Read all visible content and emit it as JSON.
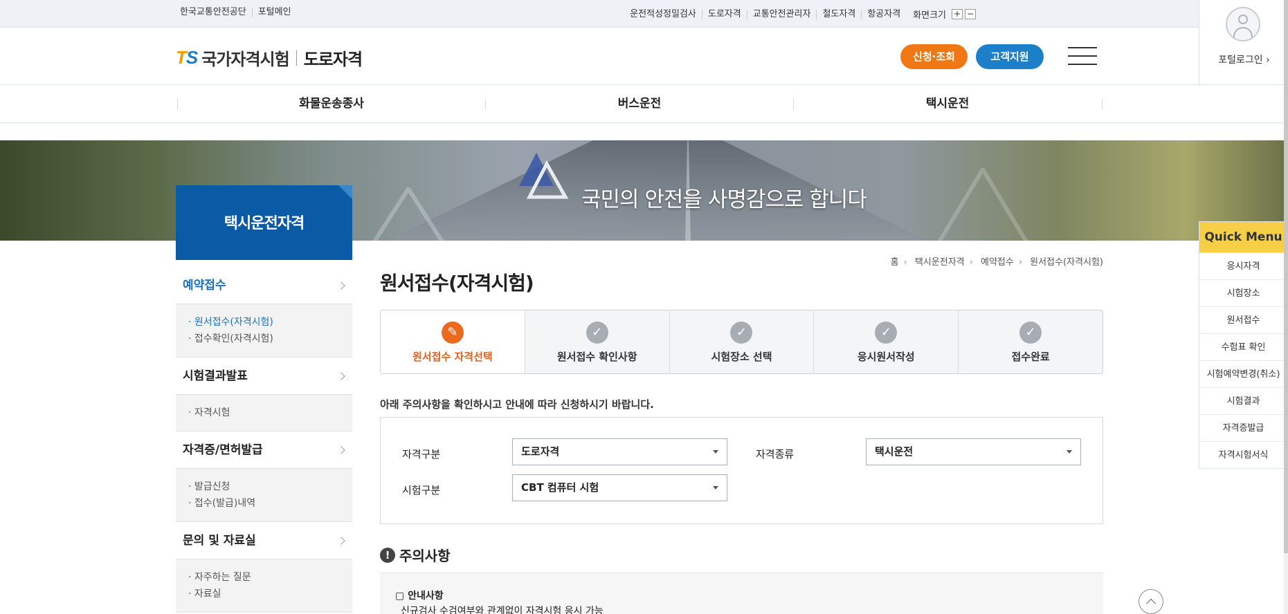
{
  "util": {
    "left": [
      "한국교통안전공단",
      "포털메인"
    ],
    "right": [
      "운전적성정밀검사",
      "도로자격",
      "교통안전관리자",
      "철도자격",
      "항공자격"
    ],
    "font_size_label": "화면크기",
    "plus": "+",
    "minus": "−"
  },
  "header": {
    "logo_t": "T",
    "logo_s": "S",
    "logo_name": "국가자격시험",
    "logo_sub": "도로자격",
    "apply_btn": "신청·조회",
    "support_btn": "고객지원",
    "login_label": "포털로그인 ›"
  },
  "gnb": [
    "화물운송종사",
    "버스운전",
    "택시운전"
  ],
  "banner": {
    "text": "국민의 안전을 사명감으로 합니다"
  },
  "side_title": "택시운전자격",
  "lnb": [
    {
      "label": "예약접수",
      "active": true,
      "subs": [
        "· 원서접수(자격시험)",
        "· 접수확인(자격시험)"
      ]
    },
    {
      "label": "시험결과발표",
      "active": false,
      "subs": [
        "· 자격시험"
      ]
    },
    {
      "label": "자격증/면허발급",
      "active": false,
      "subs": [
        "· 발급신청",
        "· 접수(발급)내역"
      ]
    },
    {
      "label": "문의 및 자료실",
      "active": false,
      "subs": [
        "· 자주하는 질문",
        "· 자료실"
      ]
    }
  ],
  "breadcrumb": [
    "홈",
    "택시운전자격",
    "예약접수",
    "원서접수(자격시험)"
  ],
  "page_title": "원서접수(자격시험)",
  "steps": [
    {
      "label": "원서접수 자격선택",
      "active": true
    },
    {
      "label": "원서접수 확인사항",
      "active": false
    },
    {
      "label": "시험장소 선택",
      "active": false
    },
    {
      "label": "응시원서작성",
      "active": false
    },
    {
      "label": "접수완료",
      "active": false
    }
  ],
  "notice": "아래 주의사항을 확인하시고 안내에 따라 신청하시기 바랍니다.",
  "form": {
    "qual_type_label": "자격구분",
    "qual_type_value": "도로자격",
    "qual_kind_label": "자격종류",
    "qual_kind_value": "택시운전",
    "exam_type_label": "시험구분",
    "exam_type_value": "CBT 컴퓨터 시험"
  },
  "caution": {
    "icon": "!",
    "title": "주의사항",
    "box_title": "▢ 안내사항",
    "box_text": "신규검사 수검여부와 관계없이 자격시험 응시 가능"
  },
  "quick": {
    "title": "Quick Menu",
    "items": [
      "응시자격",
      "시험장소",
      "원서접수",
      "수험표 확인",
      "시험예약변경(취소)",
      "시험결과",
      "자격증발급",
      "자격시험서식"
    ]
  },
  "colors": {
    "primary": "#0b5aa6",
    "accent": "#f07814",
    "support": "#1b7fc9",
    "quick": "#f7cf47"
  }
}
